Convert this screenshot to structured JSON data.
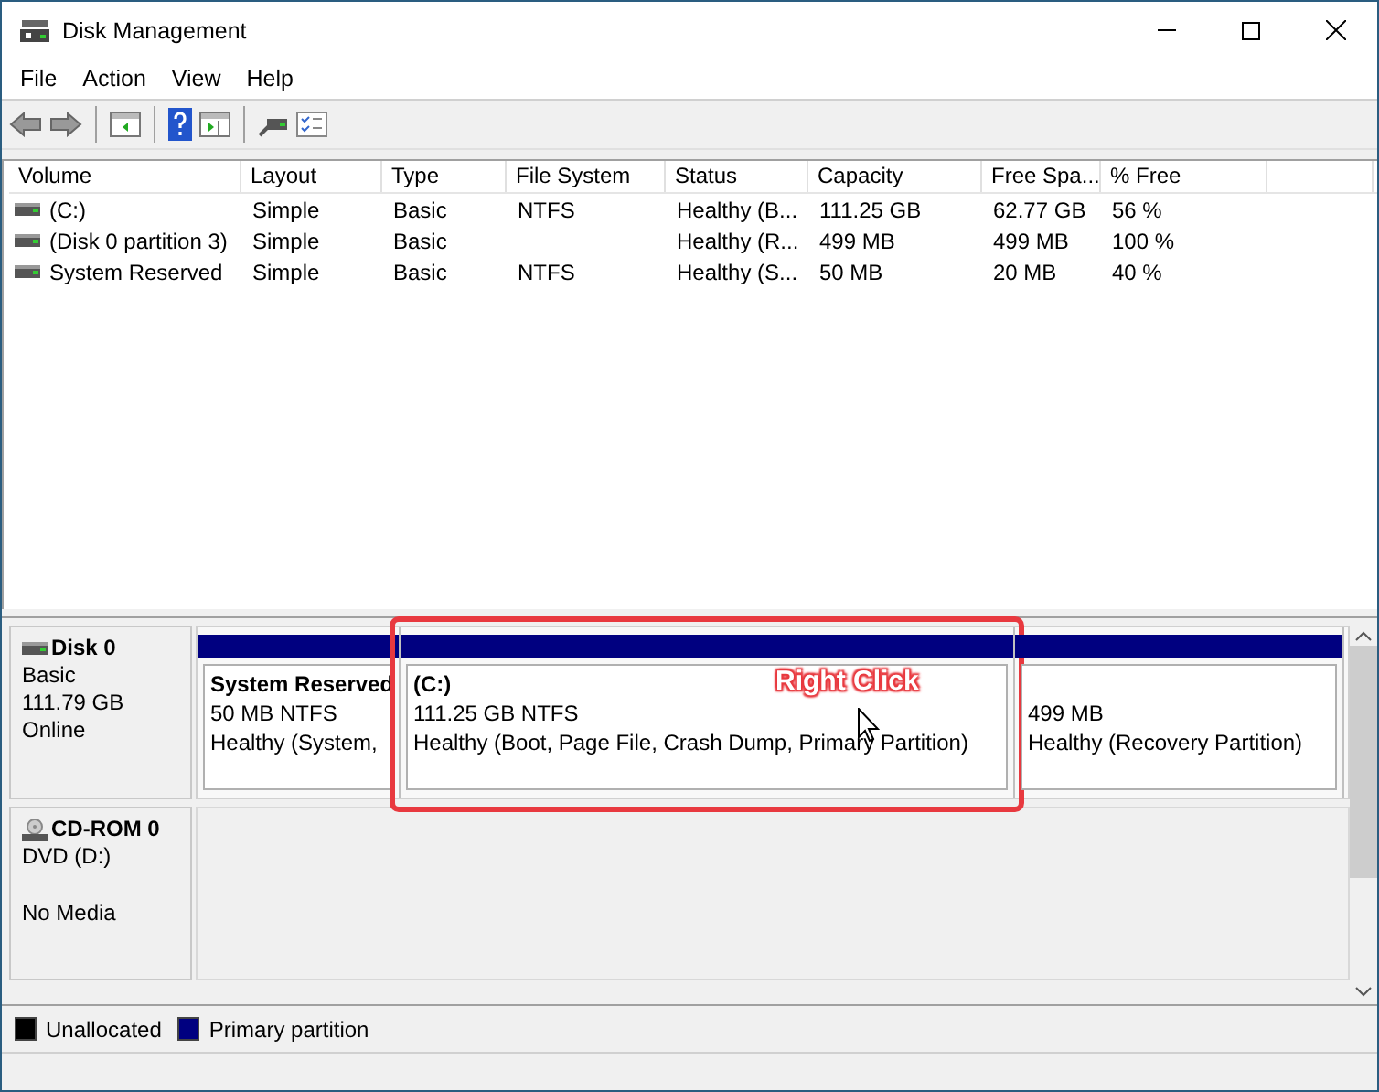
{
  "window": {
    "title": "Disk Management"
  },
  "menu": [
    "File",
    "Action",
    "View",
    "Help"
  ],
  "volume_table": {
    "columns": [
      "Volume",
      "Layout",
      "Type",
      "File System",
      "Status",
      "Capacity",
      "Free Spa...",
      "% Free"
    ],
    "rows": [
      {
        "volume": "(C:)",
        "layout": "Simple",
        "type": "Basic",
        "file_system": "NTFS",
        "status": "Healthy (B...",
        "capacity": "111.25 GB",
        "free_space": "62.77 GB",
        "percent_free": "56 %"
      },
      {
        "volume": "(Disk 0 partition 3)",
        "layout": "Simple",
        "type": "Basic",
        "status": "Healthy (R...",
        "capacity": "499 MB",
        "free_space": "499 MB",
        "percent_free": "100 %"
      },
      {
        "volume": "System Reserved",
        "layout": "Simple",
        "type": "Basic",
        "file_system": "NTFS",
        "status": "Healthy (S...",
        "capacity": "50 MB",
        "free_space": "20 MB",
        "percent_free": "40 %"
      }
    ]
  },
  "disks": [
    {
      "kind": "disk",
      "name": "Disk 0",
      "type": "Basic",
      "size": "111.79 GB",
      "status": "Online",
      "partitions": [
        {
          "kind": "primary",
          "name": "System Reserved",
          "size": "50 MB NTFS",
          "status": "Healthy (System,",
          "highlighted": false
        },
        {
          "kind": "primary",
          "name": "(C:)",
          "size": "111.25 GB NTFS",
          "status": "Healthy (Boot, Page File, Crash Dump, Primary Partition)",
          "highlighted": true
        },
        {
          "kind": "primary",
          "size": "499 MB",
          "status": "Healthy (Recovery Partition)",
          "highlighted": false
        }
      ]
    },
    {
      "kind": "cdrom",
      "name": "CD-ROM 0",
      "type": "DVD (D:)",
      "status": "No Media"
    }
  ],
  "callout": "Right Click",
  "legend": [
    {
      "label": "Unallocated",
      "color": "#000000"
    },
    {
      "label": "Primary partition",
      "color": "#000080"
    }
  ]
}
